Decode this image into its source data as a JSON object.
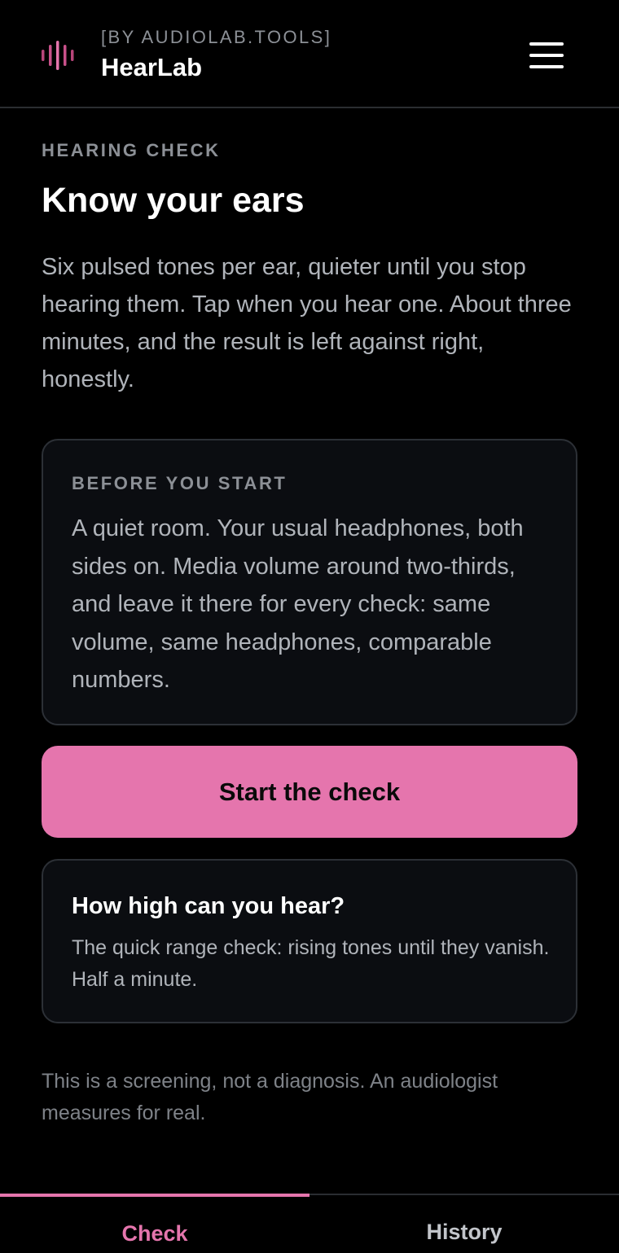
{
  "header": {
    "tag": "[BY AUDIOLAB.TOOLS]",
    "app_name": "HearLab",
    "logo_icon": "sound-wave-icon",
    "menu_icon": "hamburger-menu-icon"
  },
  "main": {
    "eyebrow": "HEARING CHECK",
    "title": "Know your ears",
    "intro": "Six pulsed tones per ear, quieter until you stop hearing them. Tap when you hear one. About three minutes, and the result is left against right, honestly."
  },
  "before_card": {
    "eyebrow": "BEFORE YOU START",
    "body": "A quiet room. Your usual headphones, both sides on. Media volume around two-thirds, and leave it there for every check: same volume, same headphones, comparable numbers."
  },
  "start_button": {
    "label": "Start the check"
  },
  "range_card": {
    "title": "How high can you hear?",
    "body": "The quick range check: rising tones until they vanish. Half a minute."
  },
  "disclaimer": "This is a screening, not a diagnosis. An audiologist measures for real.",
  "tabs": [
    {
      "label": "Check",
      "active": true
    },
    {
      "label": "History",
      "active": false
    }
  ],
  "colors": {
    "accent": "#e575ad",
    "background": "#000000",
    "card": "#0b0d11",
    "border": "#2c3036",
    "muted_text": "#b0b4ba"
  }
}
